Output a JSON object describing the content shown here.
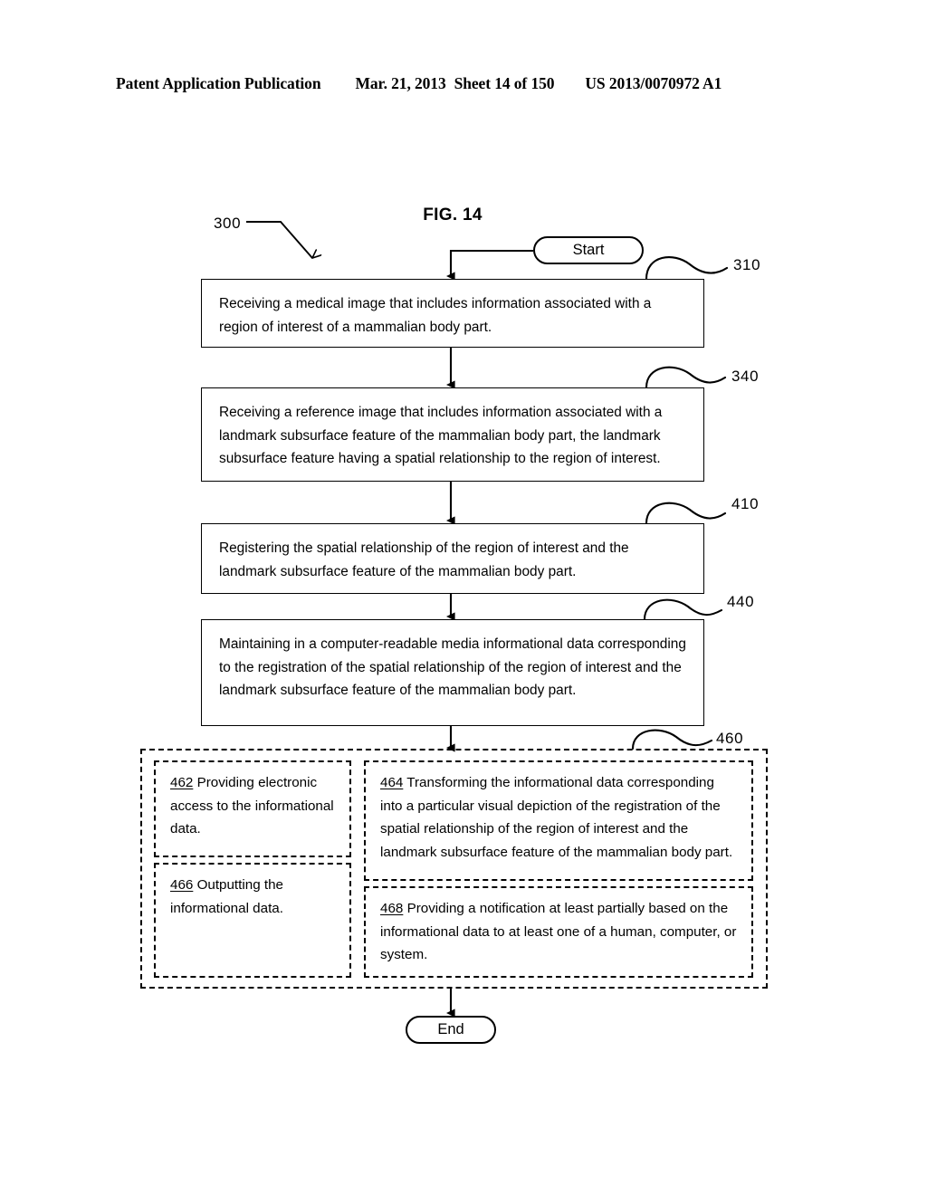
{
  "header": {
    "publication": "Patent Application Publication",
    "date": "Mar. 21, 2013",
    "sheet": "Sheet 14 of 150",
    "patent_number": "US 2013/0070972 A1"
  },
  "figure": {
    "title": "FIG. 14",
    "flowchart_id": "300",
    "start_label": "Start",
    "end_label": "End",
    "callouts": {
      "c310": "310",
      "c340": "340",
      "c410": "410",
      "c440": "440",
      "c460": "460"
    },
    "steps": [
      {
        "ref": "310",
        "text": "Receiving a medical image that includes information associated with a region of interest of a mammalian body part."
      },
      {
        "ref": "340",
        "text": "Receiving a reference image that includes information associated with a landmark subsurface feature of the mammalian body part, the landmark subsurface feature having a spatial relationship to the region of interest."
      },
      {
        "ref": "410",
        "text": "Registering the spatial relationship of the region of interest and the landmark subsurface feature of the mammalian body part."
      },
      {
        "ref": "440",
        "text": "Maintaining in a computer-readable media informational data corresponding to the registration of the spatial relationship of the region of interest and the landmark subsurface feature of the mammalian body part."
      }
    ],
    "optional_group": {
      "ref": "460",
      "sub_steps": [
        {
          "num": "462",
          "text": " Providing electronic access to the informational data."
        },
        {
          "num": "464",
          "text": " Transforming the informational data corresponding into a particular visual depiction of the registration of the spatial relationship of the region of interest and the landmark subsurface feature of the mammalian body part."
        },
        {
          "num": "466",
          "text": " Outputting the informational data."
        },
        {
          "num": "468",
          "text": " Providing a notification at least partially based on the informational data to at least one of a human, computer, or system."
        }
      ]
    }
  }
}
